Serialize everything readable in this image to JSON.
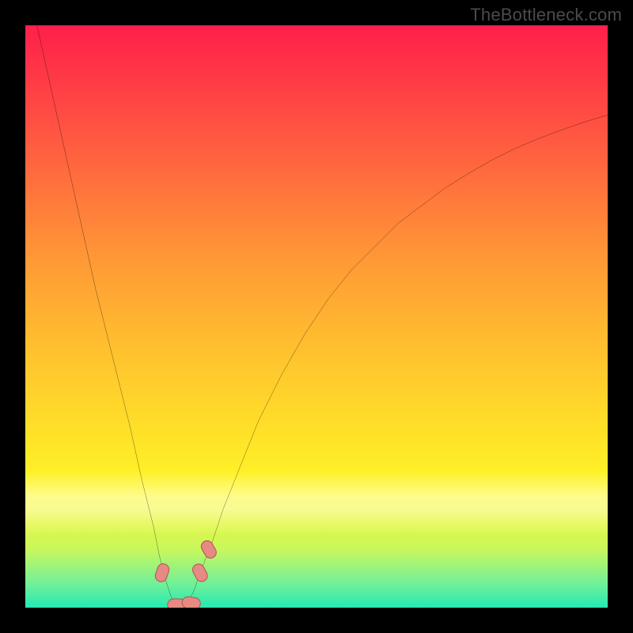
{
  "watermark": {
    "text": "TheBottleneck.com"
  },
  "chart_data": {
    "type": "line",
    "title": "",
    "xlabel": "",
    "ylabel": "",
    "xlim": [
      0,
      100
    ],
    "ylim": [
      0,
      100
    ],
    "grid": false,
    "series": [
      {
        "name": "bottleneck-curve",
        "x": [
          2,
          4,
          6,
          8,
          10,
          12,
          14,
          16,
          18,
          20,
          21,
          22,
          23,
          24,
          25,
          26,
          27,
          28,
          29,
          30,
          32,
          34,
          36,
          38,
          40,
          44,
          48,
          52,
          56,
          60,
          64,
          68,
          72,
          76,
          80,
          84,
          88,
          92,
          96,
          100
        ],
        "values": [
          100,
          91,
          82,
          73,
          64,
          55,
          47,
          39,
          31,
          22,
          18,
          14,
          9,
          5,
          2,
          0,
          0,
          1,
          3,
          6,
          11,
          17,
          22,
          27,
          32,
          40,
          47,
          53,
          58,
          62,
          66,
          69,
          72,
          74.5,
          76.8,
          78.8,
          80.5,
          82,
          83.4,
          84.6
        ]
      }
    ],
    "markers": [
      {
        "name": "pill-left-low",
        "x": 23.5,
        "y": 6,
        "angle": -72
      },
      {
        "name": "pill-bottom-1",
        "x": 26.0,
        "y": 0.5,
        "angle": 0
      },
      {
        "name": "pill-bottom-2",
        "x": 28.5,
        "y": 0.8,
        "angle": 8
      },
      {
        "name": "pill-right-low",
        "x": 30.0,
        "y": 6,
        "angle": 62
      },
      {
        "name": "pill-right-up",
        "x": 31.5,
        "y": 10,
        "angle": 60
      }
    ],
    "marker_style": {
      "fill": "#e68a83",
      "stroke": "#b55a54",
      "rx": 7,
      "w": 22,
      "h": 14
    },
    "background": {
      "type": "vertical-gradient",
      "stops": [
        {
          "pos": 0,
          "color": "#ff1f4a"
        },
        {
          "pos": 25,
          "color": "#ff6a3e"
        },
        {
          "pos": 55,
          "color": "#ffbf2f"
        },
        {
          "pos": 80,
          "color": "#fef727"
        },
        {
          "pos": 100,
          "color": "#25e9b3"
        }
      ]
    }
  }
}
